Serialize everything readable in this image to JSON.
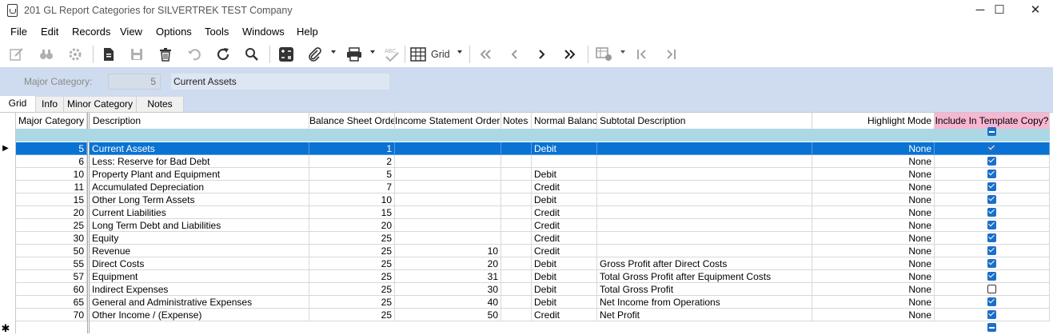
{
  "window": {
    "title": "201 GL Report Categories for SILVERTREK TEST Company",
    "minimize": "─",
    "maximize": "☐",
    "close": "✕"
  },
  "menu": [
    "File",
    "Edit",
    "Records",
    "View",
    "Options",
    "Tools",
    "Windows",
    "Help"
  ],
  "toolbar": {
    "grid_label": "Grid"
  },
  "header": {
    "major_category_label": "Major Category:",
    "major_category_value": "5",
    "description_value": "Current Assets"
  },
  "tabs": [
    "Grid",
    "Info",
    "Minor Category",
    "Notes"
  ],
  "columns": [
    "Major Category",
    "Description",
    "Balance Sheet Order",
    "Income Statement Order",
    "Notes",
    "Normal Balance",
    "Subtotal Description",
    "Highlight Mode",
    "Include In Template Copy?"
  ],
  "rows": [
    {
      "major": "5",
      "desc": "Current Assets",
      "bs": "1",
      "is": "",
      "notes": "",
      "normal": "Debit",
      "subtotal": "",
      "highlight": "None",
      "include": true
    },
    {
      "major": "6",
      "desc": "Less:  Reserve for Bad Debt",
      "bs": "2",
      "is": "",
      "notes": "",
      "normal": "",
      "subtotal": "",
      "highlight": "None",
      "include": true
    },
    {
      "major": "10",
      "desc": "Property Plant and Equipment",
      "bs": "5",
      "is": "",
      "notes": "",
      "normal": "Debit",
      "subtotal": "",
      "highlight": "None",
      "include": true
    },
    {
      "major": "11",
      "desc": "Accumulated Depreciation",
      "bs": "7",
      "is": "",
      "notes": "",
      "normal": "Credit",
      "subtotal": "",
      "highlight": "None",
      "include": true
    },
    {
      "major": "15",
      "desc": "Other Long Term Assets",
      "bs": "10",
      "is": "",
      "notes": "",
      "normal": "Debit",
      "subtotal": "",
      "highlight": "None",
      "include": true
    },
    {
      "major": "20",
      "desc": "Current Liabilities",
      "bs": "15",
      "is": "",
      "notes": "",
      "normal": "Credit",
      "subtotal": "",
      "highlight": "None",
      "include": true
    },
    {
      "major": "25",
      "desc": "Long Term Debt and Liabilities",
      "bs": "20",
      "is": "",
      "notes": "",
      "normal": "Credit",
      "subtotal": "",
      "highlight": "None",
      "include": true
    },
    {
      "major": "30",
      "desc": "Equity",
      "bs": "25",
      "is": "",
      "notes": "",
      "normal": "Credit",
      "subtotal": "",
      "highlight": "None",
      "include": true
    },
    {
      "major": "50",
      "desc": "Revenue",
      "bs": "25",
      "is": "10",
      "notes": "",
      "normal": "Credit",
      "subtotal": "",
      "highlight": "None",
      "include": true
    },
    {
      "major": "55",
      "desc": "Direct Costs",
      "bs": "25",
      "is": "20",
      "notes": "",
      "normal": "Debit",
      "subtotal": "Gross Profit after Direct Costs",
      "highlight": "None",
      "include": true
    },
    {
      "major": "57",
      "desc": "Equipment",
      "bs": "25",
      "is": "31",
      "notes": "",
      "normal": "Debit",
      "subtotal": "Total Gross Profit after Equipment Costs",
      "highlight": "None",
      "include": true
    },
    {
      "major": "60",
      "desc": "Indirect Expenses",
      "bs": "25",
      "is": "30",
      "notes": "",
      "normal": "Debit",
      "subtotal": "Total Gross Profit",
      "highlight": "None",
      "include": false
    },
    {
      "major": "65",
      "desc": "General and Administrative Expenses",
      "bs": "25",
      "is": "40",
      "notes": "",
      "normal": "Debit",
      "subtotal": "Net Income from Operations",
      "highlight": "None",
      "include": true
    },
    {
      "major": "70",
      "desc": "Other Income / (Expense)",
      "bs": "25",
      "is": "50",
      "notes": "",
      "normal": "Credit",
      "subtotal": "Net Profit",
      "highlight": "None",
      "include": true
    }
  ],
  "colors": {
    "selected_row": "#0a72d2",
    "filter_row": "#acd8e6",
    "header_panel": "#cfdbee",
    "highlight_header": "#f7b6d2",
    "checkbox": "#1b6fc8"
  }
}
